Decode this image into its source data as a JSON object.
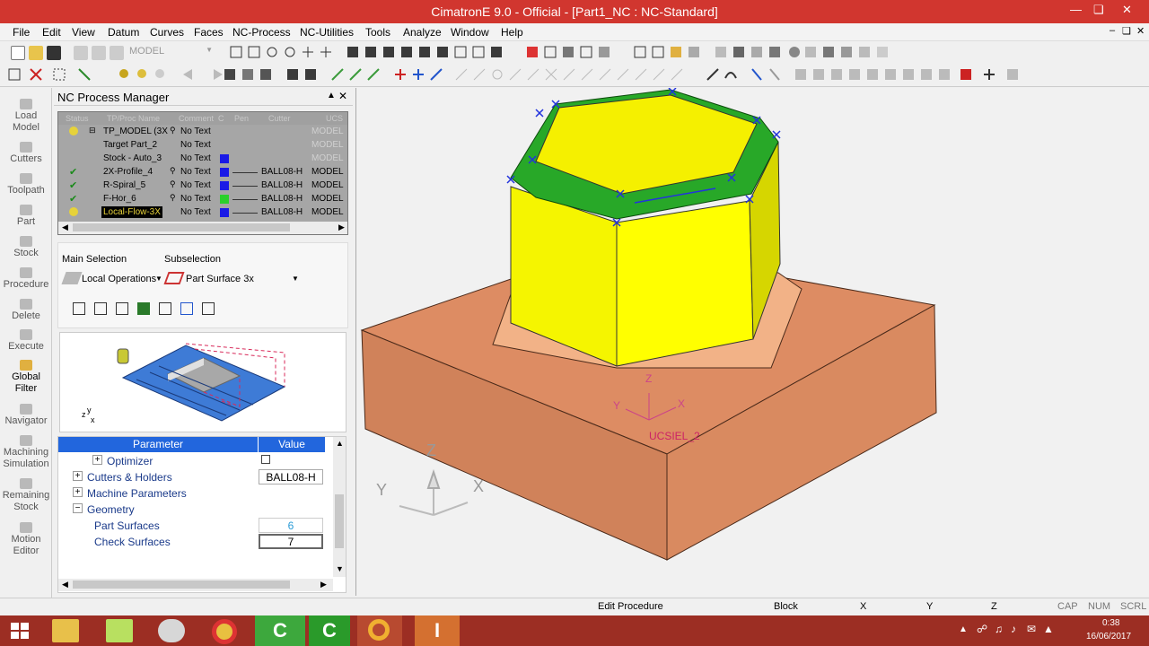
{
  "window": {
    "title": "CimatronE 9.0 - Official - [Part1_NC : NC-Standard]"
  },
  "menu": [
    "File",
    "Edit",
    "View",
    "Datum",
    "Curves",
    "Faces",
    "NC-Process",
    "NC-Utilities",
    "Tools",
    "Analyze",
    "Window",
    "Help"
  ],
  "toolbar": {
    "model_dropdown": "MODEL"
  },
  "left_toolbar": [
    {
      "label": "Load\nModel"
    },
    {
      "label": "Cutters"
    },
    {
      "label": "Toolpath"
    },
    {
      "label": "Part"
    },
    {
      "label": "Stock"
    },
    {
      "label": "Procedure"
    },
    {
      "label": "Delete"
    },
    {
      "label": "Execute"
    },
    {
      "label": "Global\nFilter"
    },
    {
      "label": "Navigator"
    },
    {
      "label": "Machining\nSimulation"
    },
    {
      "label": "Remaining\nStock"
    },
    {
      "label": "Motion\nEditor"
    }
  ],
  "panel": {
    "title": "NC Process Manager",
    "columns": [
      "Status",
      "TP/Proc Name",
      "Comment",
      "C",
      "Pen",
      "Cutter",
      "UCS"
    ],
    "rows": [
      {
        "name": "TP_MODEL (3X",
        "comment": "No Text",
        "cutter": "",
        "ucs": "MODEL",
        "color": ""
      },
      {
        "name": "Target Part_2",
        "comment": "No Text",
        "cutter": "",
        "ucs": "MODEL",
        "color": ""
      },
      {
        "name": "Stock - Auto_3",
        "comment": "No Text",
        "cutter": "",
        "ucs": "MODEL",
        "color": "#1a1ae6"
      },
      {
        "name": "2X-Profile_4",
        "comment": "No Text",
        "cutter": "BALL08-H",
        "ucs": "MODEL",
        "color": "#1a1ae6"
      },
      {
        "name": "R-Spiral_5",
        "comment": "No Text",
        "cutter": "BALL08-H",
        "ucs": "MODEL",
        "color": "#1a1ae6"
      },
      {
        "name": "F-Hor_6",
        "comment": "No Text",
        "cutter": "BALL08-H",
        "ucs": "MODEL",
        "color": "#2ad02a"
      },
      {
        "name": "Local-Flow-3X",
        "comment": "No Text",
        "cutter": "BALL08-H",
        "ucs": "MODEL",
        "color": "#1a1ae6"
      }
    ],
    "main_selection_label": "Main Selection",
    "subselection_label": "Subselection",
    "main_selection_value": "Local Operations",
    "subselection_value": "Part Surface 3x",
    "param_header": {
      "parameter": "Parameter",
      "value": "Value"
    },
    "params": [
      {
        "name": "Optimizer",
        "value": ""
      },
      {
        "name": "Cutters & Holders",
        "value": "BALL08-H"
      },
      {
        "name": "Machine Parameters",
        "value": ""
      },
      {
        "name": "Geometry",
        "value": ""
      },
      {
        "name": "Part Surfaces",
        "value": "6"
      },
      {
        "name": "Check Surfaces",
        "value": "7"
      }
    ]
  },
  "viewport": {
    "ucs_label": "UCSIEL_2",
    "axis_z": "Z",
    "axis_x": "X",
    "axis_y": "Y"
  },
  "status": {
    "mode": "Edit Procedure",
    "block": "Block",
    "x": "X",
    "y": "Y",
    "z": "Z",
    "cap": "CAP",
    "num": "NUM",
    "scrl": "SCRL"
  },
  "taskbar": {
    "time": "0:38",
    "date": "16/06/2017"
  }
}
